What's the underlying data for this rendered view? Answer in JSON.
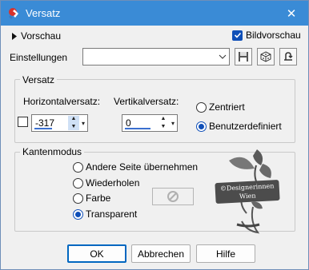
{
  "window": {
    "title": "Versatz",
    "close_glyph": "✕"
  },
  "preview": {
    "label": "Vorschau",
    "toggle_icon": "triangle-right-icon"
  },
  "bildvorschau": {
    "label": "Bildvorschau",
    "checked": true
  },
  "settings": {
    "label": "Einstellungen",
    "value": "",
    "buttons": [
      "save-preset-icon",
      "randomize-icon",
      "reset-icon"
    ]
  },
  "versatz": {
    "group_label": "Versatz",
    "horizontal_label": "Horizontalversatz:",
    "horizontal_value": "-317",
    "vertical_label": "Vertikalversatz:",
    "vertical_value": "0",
    "options": [
      {
        "label": "Zentriert",
        "checked": false
      },
      {
        "label": "Benutzerdefiniert",
        "checked": true
      }
    ]
  },
  "kantenmodus": {
    "group_label": "Kantenmodus",
    "options": [
      {
        "label": "Andere Seite übernehmen",
        "checked": false
      },
      {
        "label": "Wiederholen",
        "checked": false
      },
      {
        "label": "Farbe",
        "checked": false
      },
      {
        "label": "Transparent",
        "checked": true
      }
    ]
  },
  "watermark": {
    "line1": "©Designerinnen",
    "line2": "Wien"
  },
  "buttons": {
    "ok": "OK",
    "cancel": "Abbrechen",
    "help": "Hilfe"
  },
  "colors": {
    "titlebar": "#3a8bd6",
    "accent": "#0f4fb8",
    "default_button_border": "#0067c0"
  }
}
